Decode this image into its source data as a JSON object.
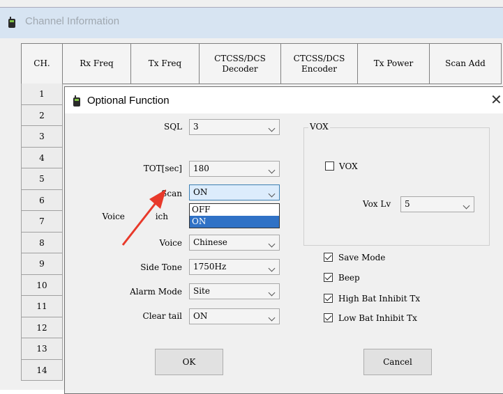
{
  "window": {
    "title": "Channel Information"
  },
  "table": {
    "headers": [
      "CH.",
      "Rx Freq",
      "Tx Freq",
      "CTCSS/DCS\nDecoder",
      "CTCSS/DCS\nEncoder",
      "Tx Power",
      "Scan Add"
    ],
    "rows": [
      "1",
      "2",
      "3",
      "4",
      "5",
      "6",
      "7",
      "8",
      "9",
      "10",
      "11",
      "12",
      "13",
      "14"
    ]
  },
  "dialog": {
    "title": "Optional Function",
    "close_glyph": "✕",
    "fields": {
      "sql": {
        "label": "SQL",
        "value": "3"
      },
      "tot": {
        "label": "TOT[sec]",
        "value": "180"
      },
      "scan": {
        "label": "Scan",
        "value": "ON",
        "options": [
          "OFF",
          "ON"
        ],
        "highlighted": "ON"
      },
      "voice_switch": {
        "label": "Voice ",
        "label_tail": "ich"
      },
      "voice": {
        "label": "Voice",
        "value": "Chinese"
      },
      "side_tone": {
        "label": "Side Tone",
        "value": "1750Hz"
      },
      "alarm_mode": {
        "label": "Alarm Mode",
        "value": "Site"
      },
      "clear_tail": {
        "label": "Clear tail",
        "value": "ON"
      }
    },
    "vox_group": {
      "legend": "VOX",
      "vox_check": {
        "label": "VOX",
        "checked": false
      },
      "vox_lv": {
        "label": "Vox Lv",
        "value": "5"
      }
    },
    "checks": [
      {
        "label": "Save Mode",
        "checked": true
      },
      {
        "label": "Beep",
        "checked": true
      },
      {
        "label": "High Bat Inhibit Tx",
        "checked": true
      },
      {
        "label": "Low Bat Inhibit Tx",
        "checked": true
      }
    ],
    "buttons": {
      "ok": "OK",
      "cancel": "Cancel"
    }
  },
  "annotation": {
    "arrow_color": "#e8392a"
  }
}
